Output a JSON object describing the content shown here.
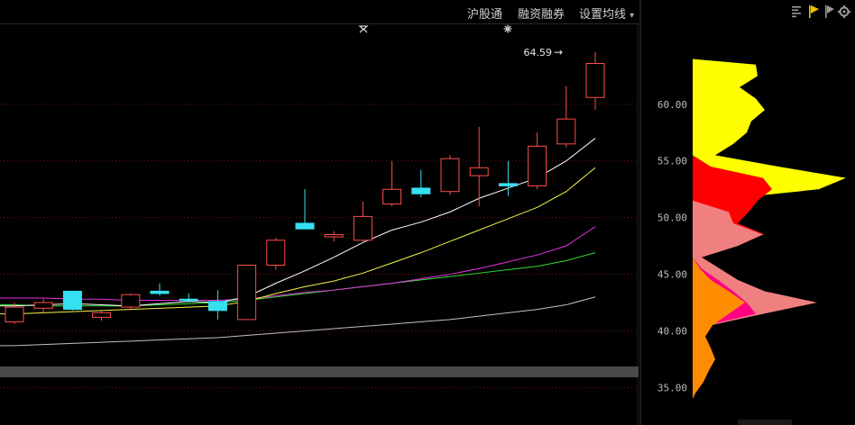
{
  "toolbar": {
    "hsgt_label": "沪股通",
    "margin_label": "融资融券",
    "ma_settings_label": "设置均线",
    "ma_settings_arrow": "▾"
  },
  "right_toolbar": {
    "icons": [
      "bars-icon",
      "play-icon",
      "flag-icon",
      "gear-icon"
    ]
  },
  "colors": {
    "up": "#ff4c4c",
    "down": "#35e0f0",
    "ma5": "#ffffff",
    "ma10": "#f3f34a",
    "ma20": "#e533e5",
    "ma30": "#33dd33",
    "ma60": "#c0c0c0",
    "grid": "#7a1010"
  },
  "chart_data": {
    "type": "candlestick",
    "ylim": [
      34.0,
      66.5
    ],
    "yticks": [
      "35.00",
      "40.00",
      "45.00",
      "50.00",
      "55.00",
      "60.00"
    ],
    "max_annotation": "64.59",
    "max_arrow": "→",
    "candles": [
      {
        "o": 40.8,
        "h": 42.5,
        "l": 40.6,
        "c": 42.1
      },
      {
        "o": 42.0,
        "h": 42.8,
        "l": 41.6,
        "c": 42.5
      },
      {
        "o": 43.5,
        "h": 43.5,
        "l": 41.8,
        "c": 41.9
      },
      {
        "o": 41.2,
        "h": 41.8,
        "l": 40.9,
        "c": 41.6
      },
      {
        "o": 42.1,
        "h": 43.3,
        "l": 41.8,
        "c": 43.2
      },
      {
        "o": 43.5,
        "h": 44.2,
        "l": 43.1,
        "c": 43.3
      },
      {
        "o": 42.8,
        "h": 43.3,
        "l": 42.5,
        "c": 42.7
      },
      {
        "o": 42.6,
        "h": 43.6,
        "l": 41.0,
        "c": 41.8
      },
      {
        "o": 41.0,
        "h": 45.8,
        "l": 41.0,
        "c": 45.8
      },
      {
        "o": 45.8,
        "h": 48.2,
        "l": 45.4,
        "c": 48.0
      },
      {
        "o": 49.5,
        "h": 52.5,
        "l": 49.1,
        "c": 49.0
      },
      {
        "o": 48.3,
        "h": 48.8,
        "l": 47.9,
        "c": 48.5
      },
      {
        "o": 48.0,
        "h": 51.4,
        "l": 47.9,
        "c": 50.1
      },
      {
        "o": 51.2,
        "h": 55.0,
        "l": 51.0,
        "c": 52.5
      },
      {
        "o": 52.6,
        "h": 54.2,
        "l": 51.8,
        "c": 52.1
      },
      {
        "o": 52.3,
        "h": 55.5,
        "l": 52.0,
        "c": 55.2
      },
      {
        "o": 53.7,
        "h": 58.0,
        "l": 51.0,
        "c": 54.4
      },
      {
        "o": 53.0,
        "h": 55.0,
        "l": 51.9,
        "c": 52.8
      },
      {
        "o": 52.8,
        "h": 57.5,
        "l": 52.5,
        "c": 56.3
      },
      {
        "o": 56.5,
        "h": 61.6,
        "l": 56.2,
        "c": 58.7
      },
      {
        "o": 60.6,
        "h": 64.6,
        "l": 59.5,
        "c": 63.6
      }
    ],
    "ma5": [
      42.2,
      42.3,
      42.4,
      42.3,
      42.2,
      42.4,
      42.6,
      42.5,
      43.0,
      44.2,
      45.3,
      46.5,
      47.8,
      48.9,
      49.6,
      50.5,
      51.7,
      52.6,
      53.5,
      55.0,
      57.0
    ],
    "ma10": [
      41.5,
      41.6,
      41.7,
      41.8,
      41.9,
      42.0,
      42.1,
      42.2,
      42.6,
      43.3,
      43.9,
      44.4,
      45.1,
      46.0,
      46.9,
      47.9,
      48.9,
      49.9,
      50.9,
      52.3,
      54.4
    ],
    "ma20": [
      42.9,
      42.9,
      42.8,
      42.8,
      42.7,
      42.7,
      42.7,
      42.7,
      42.8,
      43.1,
      43.4,
      43.6,
      43.9,
      44.2,
      44.6,
      45.0,
      45.5,
      46.1,
      46.7,
      47.5,
      49.2
    ],
    "ma30": [
      42.3,
      42.2,
      42.2,
      42.2,
      42.2,
      42.3,
      42.4,
      42.5,
      42.7,
      43.0,
      43.3,
      43.6,
      43.9,
      44.2,
      44.5,
      44.8,
      45.1,
      45.4,
      45.7,
      46.2,
      46.9
    ],
    "ma60": [
      38.7,
      38.8,
      38.9,
      39.0,
      39.1,
      39.2,
      39.3,
      39.4,
      39.6,
      39.8,
      40.0,
      40.2,
      40.4,
      40.6,
      40.8,
      41.0,
      41.3,
      41.6,
      41.9,
      42.3,
      43.0
    ],
    "chip_distribution": {
      "bins": [
        34.5,
        35.5,
        36.5,
        37.5,
        38.5,
        39.5,
        40.5,
        41.5,
        42.5,
        43.5,
        44.5,
        45.5,
        46.5,
        47.5,
        48.5,
        49.5,
        50.5,
        51.5,
        52.5,
        53.5,
        54.5,
        55.5,
        56.5,
        57.5,
        58.5,
        59.5,
        60.5,
        61.5,
        62.5,
        63.5
      ],
      "layers": [
        {
          "name": "",
          "color": "#ff8c00",
          "values": [
            3,
            12,
            18,
            25,
            20,
            14,
            22,
            40,
            58,
            40,
            20,
            8,
            0,
            0,
            0,
            0,
            0,
            0,
            0,
            0,
            0,
            0,
            0,
            0,
            0,
            0,
            0,
            0,
            0,
            0
          ]
        },
        {
          "name": "",
          "color": "#ff0080",
          "values": [
            0,
            0,
            0,
            0,
            0,
            5,
            15,
            70,
            60,
            45,
            28,
            10,
            0,
            0,
            0,
            0,
            0,
            0,
            0,
            0,
            0,
            0,
            0,
            0,
            0,
            0,
            0,
            0,
            0,
            0
          ]
        },
        {
          "name": "",
          "color": "#f08080",
          "values": [
            0,
            0,
            0,
            0,
            0,
            8,
            20,
            78,
            138,
            80,
            50,
            30,
            10,
            50,
            78,
            45,
            40,
            0,
            0,
            0,
            0,
            0,
            0,
            0,
            0,
            0,
            0,
            0,
            0,
            0
          ]
        },
        {
          "name": "",
          "color": "#ff0000",
          "values": [
            0,
            0,
            0,
            0,
            0,
            0,
            0,
            0,
            0,
            0,
            0,
            0,
            0,
            0,
            80,
            50,
            62,
            72,
            88,
            78,
            20,
            0,
            0,
            0,
            0,
            0,
            0,
            0,
            0,
            0
          ]
        },
        {
          "name": "",
          "color": "#ffff00",
          "values": [
            0,
            0,
            0,
            0,
            0,
            0,
            0,
            0,
            0,
            0,
            0,
            0,
            0,
            0,
            0,
            0,
            0,
            20,
            140,
            170,
            95,
            25,
            45,
            60,
            65,
            80,
            70,
            52,
            72,
            70
          ]
        }
      ]
    }
  }
}
